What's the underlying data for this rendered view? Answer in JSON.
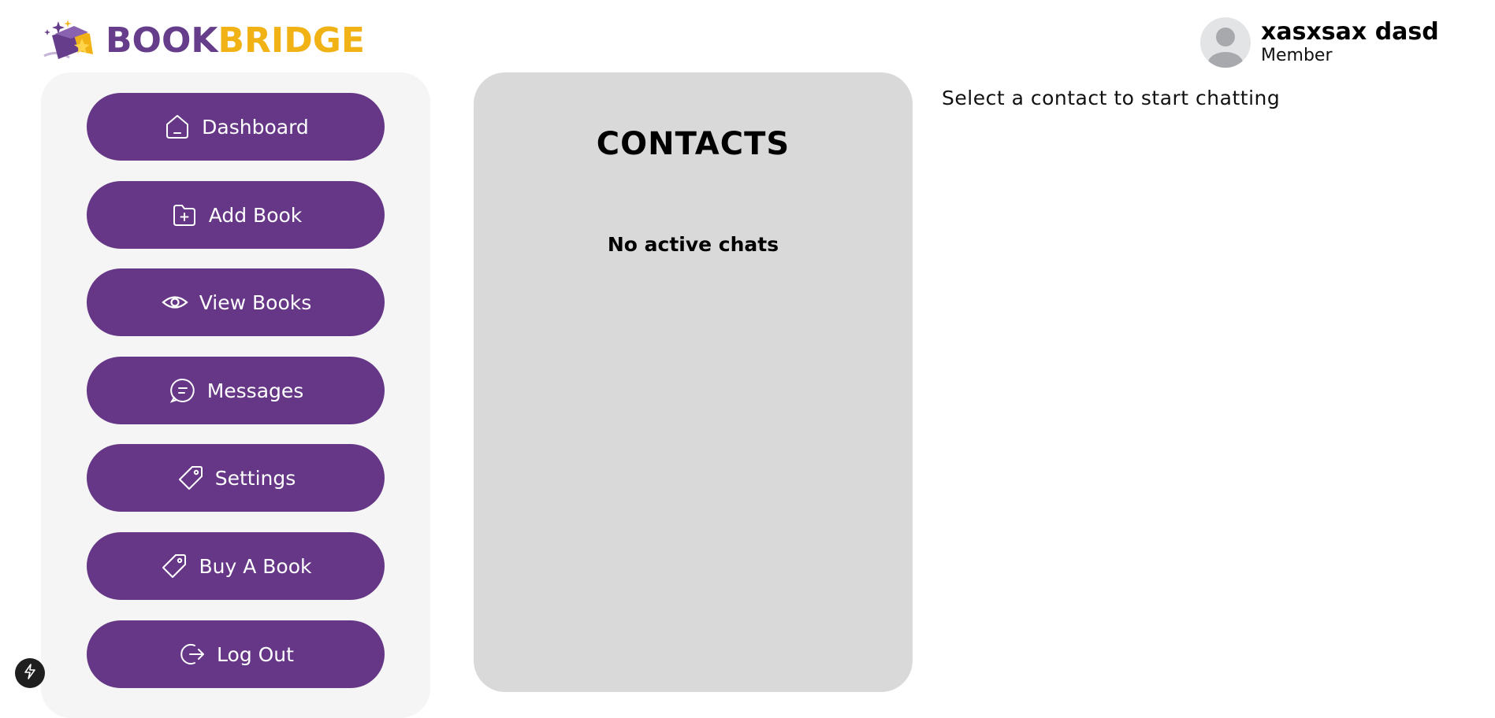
{
  "brand": {
    "part1": "BOOK",
    "part2": "BRIDGE",
    "logo_icon": "magic-book-icon",
    "colors": {
      "book": "#663d8a",
      "bridge": "#f1b215"
    }
  },
  "user": {
    "name": "xasxsax dasd",
    "role": "Member",
    "avatar_icon": "user-avatar-icon"
  },
  "sidebar": {
    "accent": "#663786",
    "items": [
      {
        "label": "Dashboard",
        "icon": "home-icon"
      },
      {
        "label": "Add Book",
        "icon": "folder-plus-icon"
      },
      {
        "label": "View Books",
        "icon": "eye-icon"
      },
      {
        "label": "Messages",
        "icon": "message-icon"
      },
      {
        "label": "Settings",
        "icon": "tag-icon"
      },
      {
        "label": "Buy A Book",
        "icon": "tag-icon"
      },
      {
        "label": "Log Out",
        "icon": "logout-icon"
      }
    ]
  },
  "contacts": {
    "title": "CONTACTS",
    "empty_text": "No active chats"
  },
  "chat": {
    "placeholder": "Select a contact to start chatting"
  },
  "badge": {
    "icon": "lightning-icon"
  }
}
